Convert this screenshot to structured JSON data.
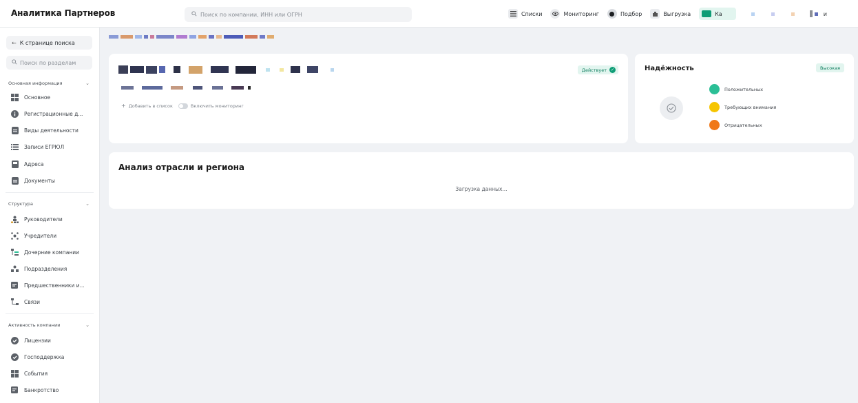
{
  "app": {
    "title": "Аналитика Партнеров"
  },
  "search": {
    "placeholder": "Поиск по компании, ИНН или ОГРН",
    "icon": "search-icon"
  },
  "topnav": {
    "items": [
      {
        "label": "Списки",
        "icon": "list-icon"
      },
      {
        "label": "Мониторинг",
        "icon": "eye-icon"
      },
      {
        "label": "Подбор",
        "icon": "target-icon"
      },
      {
        "label": "Выгрузка",
        "icon": "download-icon"
      },
      {
        "label": "Ка",
        "icon": "card-icon"
      }
    ],
    "tail_label": "и"
  },
  "sidebar": {
    "back_label": "К странице поиска",
    "search_placeholder": "Поиск по разделам",
    "groups": [
      {
        "title": "Основная информация",
        "items": [
          {
            "label": "Основное",
            "icon": "grid-icon"
          },
          {
            "label": "Регистрационные д...",
            "icon": "info-icon"
          },
          {
            "label": "Виды деятельности",
            "icon": "document-icon"
          },
          {
            "label": "Записи ЕГРЮЛ",
            "icon": "list-icon"
          },
          {
            "label": "Адреса",
            "icon": "address-icon"
          },
          {
            "label": "Документы",
            "icon": "document-icon"
          }
        ]
      },
      {
        "title": "Структура",
        "items": [
          {
            "label": "Руководители",
            "icon": "people-icon"
          },
          {
            "label": "Учредители",
            "icon": "founders-icon"
          },
          {
            "label": "Дочерние компании",
            "icon": "subsidiaries-icon"
          },
          {
            "label": "Подразделения",
            "icon": "people-icon"
          },
          {
            "label": "Предшественники и...",
            "icon": "history-icon"
          },
          {
            "label": "Связи",
            "icon": "links-icon"
          }
        ]
      },
      {
        "title": "Активность компании",
        "items": [
          {
            "label": "Лицензии",
            "icon": "badge-check-icon"
          },
          {
            "label": "Господдержка",
            "icon": "badge-check-icon"
          },
          {
            "label": "События",
            "icon": "grid-icon"
          },
          {
            "label": "Банкротство",
            "icon": "history-icon"
          }
        ]
      }
    ]
  },
  "company_card": {
    "status": "Действует",
    "add_to_list": "Добавить в список",
    "monitoring": "Включить мониторинг"
  },
  "reliability": {
    "title": "Надёжность",
    "badge": "Высокая",
    "legend": [
      {
        "label": "Положительных",
        "color": "#2bbf96"
      },
      {
        "label": "Требующих внимания",
        "color": "#f6c500"
      },
      {
        "label": "Отрицательных",
        "color": "#f07818"
      }
    ]
  },
  "analysis": {
    "title": "Анализ отрасли и региона",
    "loading": "Загрузка данных..."
  },
  "colors": {
    "accent": "#0f9d76",
    "accent_bg": "#e2f5ef",
    "background": "#f0f2f5"
  }
}
